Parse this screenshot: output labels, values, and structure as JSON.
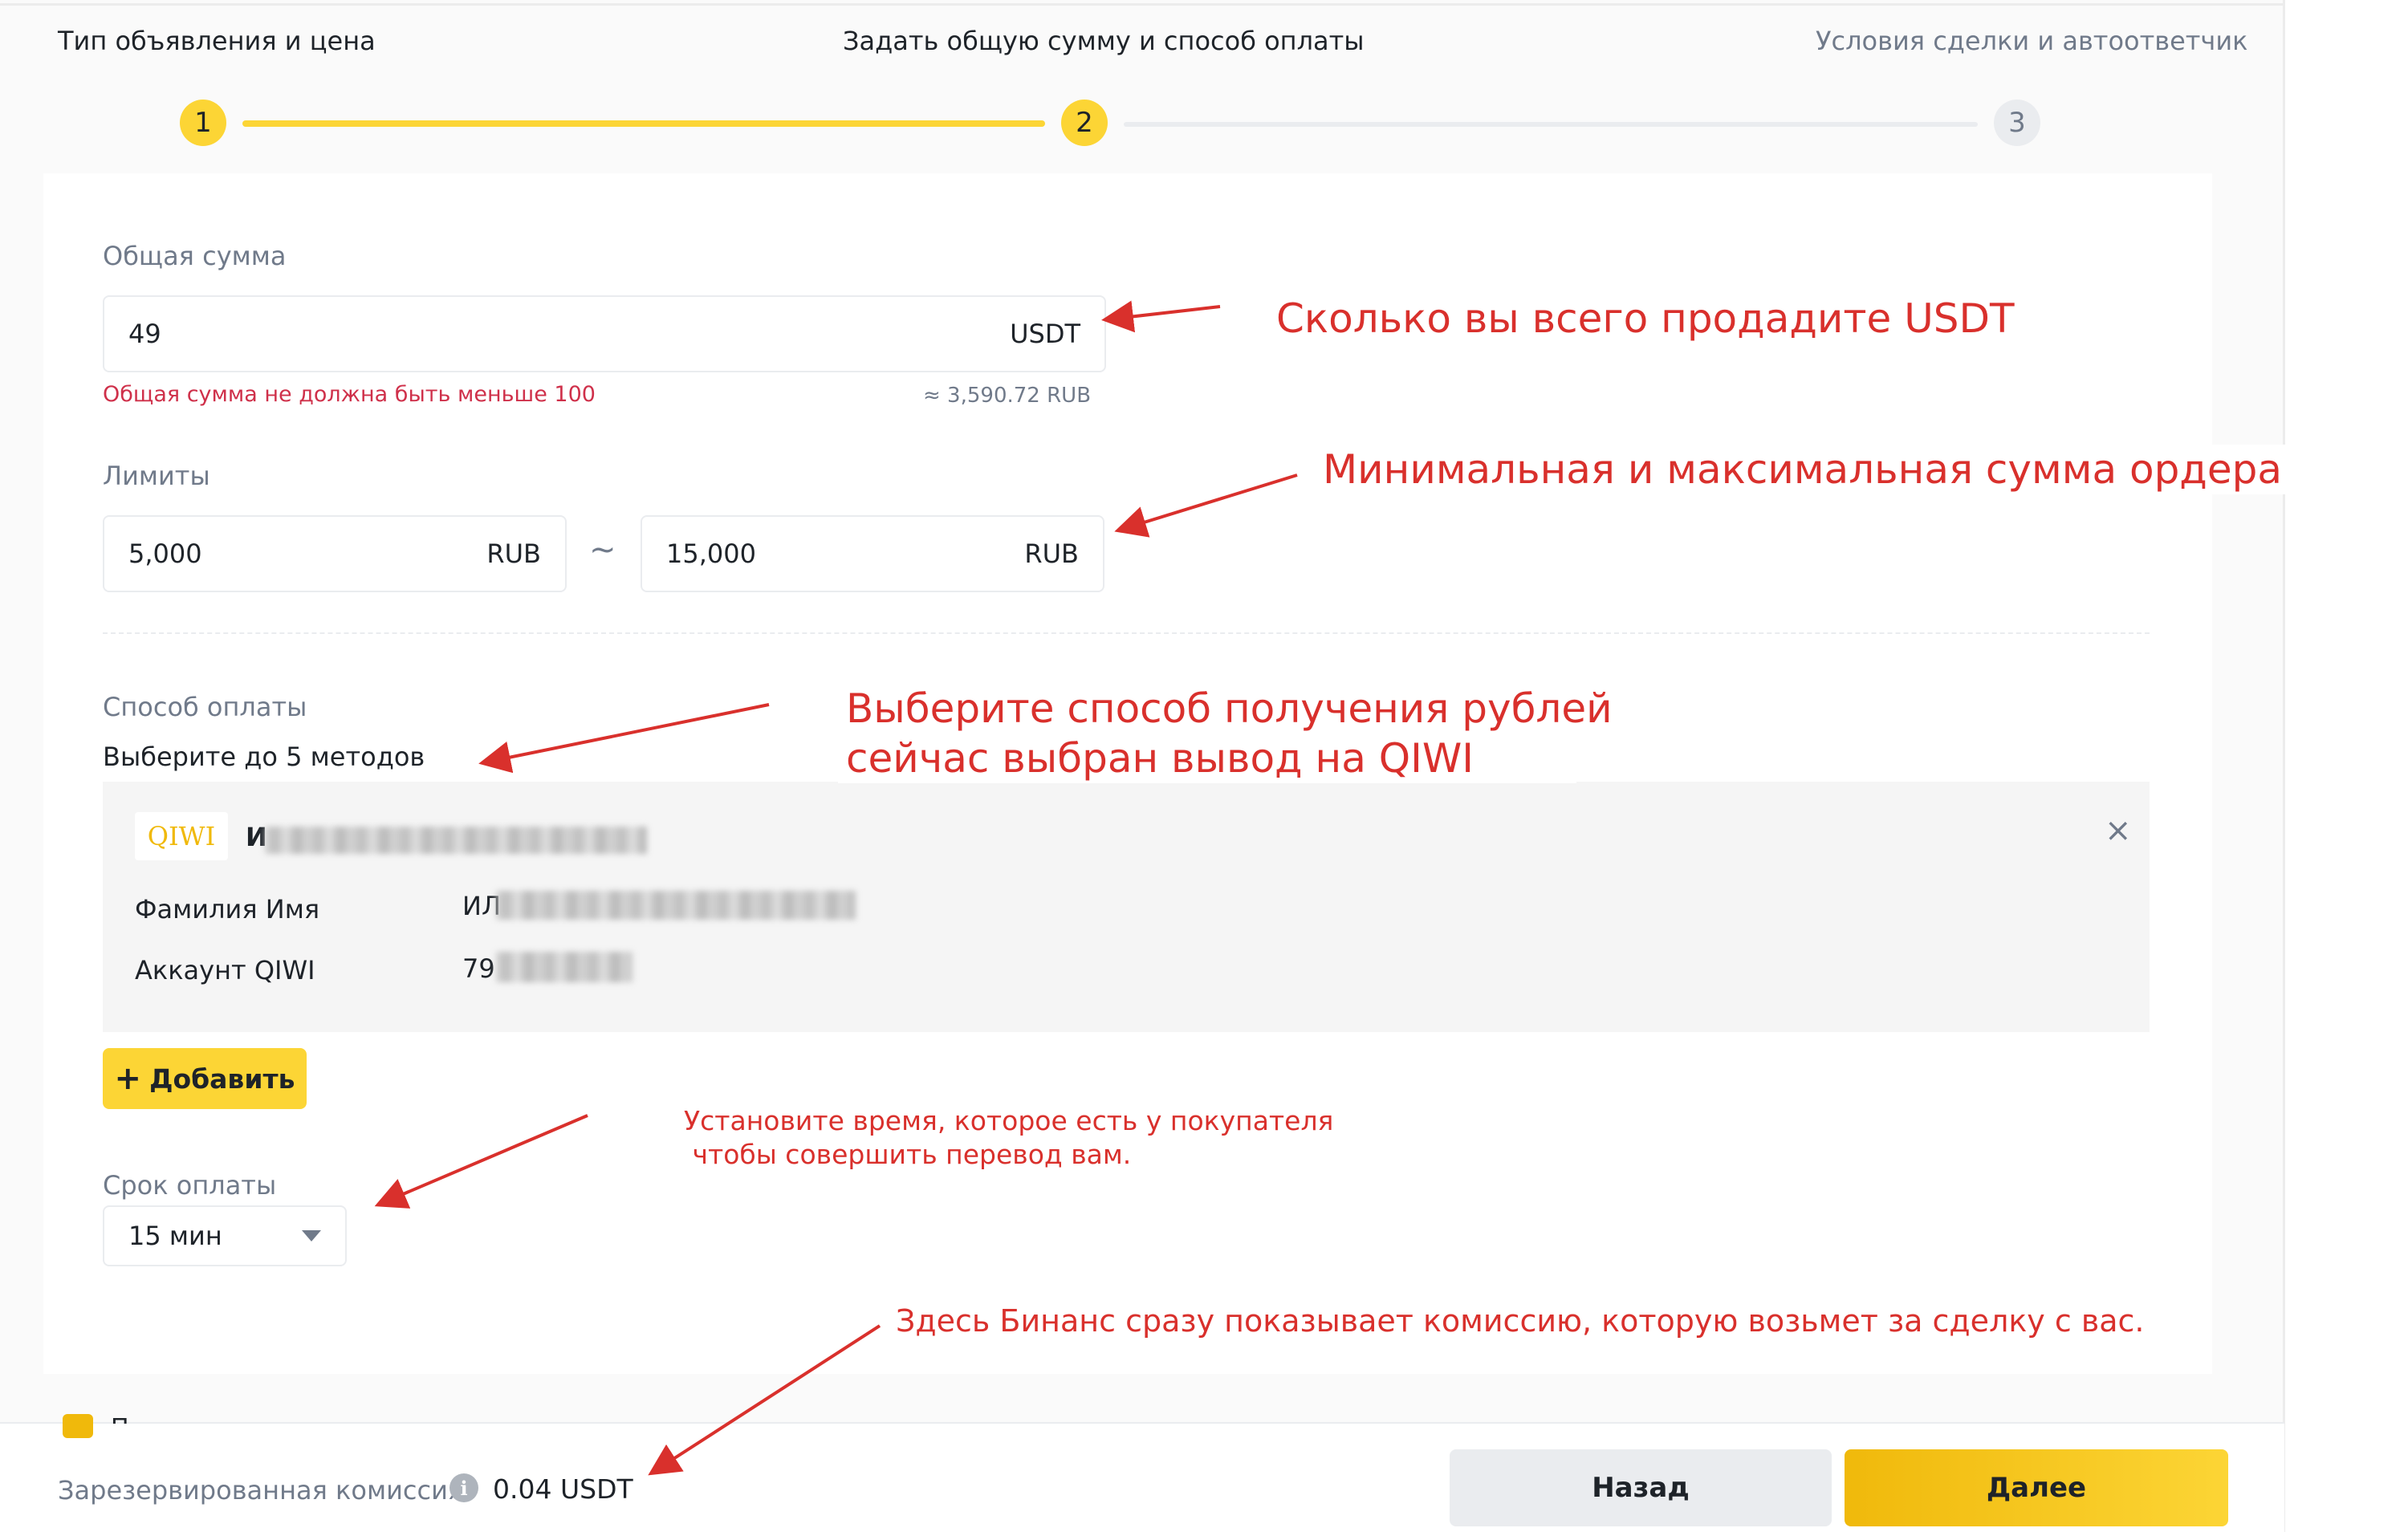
{
  "stepper": {
    "steps": [
      {
        "num": "1",
        "title": "Тип объявления и цена"
      },
      {
        "num": "2",
        "title": "Задать общую сумму и способ оплаты"
      },
      {
        "num": "3",
        "title": "Условия сделки и автоответчик"
      }
    ],
    "active_step": 2
  },
  "total": {
    "label": "Общая сумма",
    "value": "49",
    "unit": "USDT",
    "error": "Общая сумма не должна быть меньше 100",
    "approx": "≈ 3,590.72 RUB"
  },
  "limits": {
    "label": "Лимиты",
    "min_value": "5,000",
    "min_unit": "RUB",
    "separator": "~",
    "max_value": "15,000",
    "max_unit": "RUB"
  },
  "payment": {
    "label": "Способ оплаты",
    "hint": "Выберите до 5 методов",
    "method": {
      "tag": "QIWI",
      "name_visible": "И",
      "fields": [
        {
          "key": "Фамилия Имя",
          "value_visible": "ИЛ"
        },
        {
          "key": "Аккаунт QIWI",
          "value_visible": "79"
        }
      ],
      "close": "×"
    },
    "add_button": "Добавить",
    "add_icon": "+"
  },
  "pay_time": {
    "label": "Срок оплаты",
    "value": "15 мин"
  },
  "footer": {
    "peek_text": "П",
    "fee_label": "Зарезервированная комиссия",
    "info_icon": "i",
    "fee_value": "0.04 USDT",
    "back": "Назад",
    "next": "Далее"
  },
  "annotations": {
    "total": "Сколько вы всего продадите USDT",
    "limits": "Минимальная и максимальная сумма ордера",
    "payment_line1": "Выберите способ получения рублей",
    "payment_line2": "сейчас выбран вывод на QIWI",
    "time_line1": "Установите время, которое есть у покупателя",
    "time_line2": " чтобы совершить перевод вам.",
    "fee": "Здесь Бинанс сразу показывает комиссию, которую возьмет за сделку с вас."
  },
  "colors": {
    "accent": "#fcd535",
    "error": "#cf304a",
    "annotation": "#d9302c",
    "qiwi": "#f0b90b"
  }
}
